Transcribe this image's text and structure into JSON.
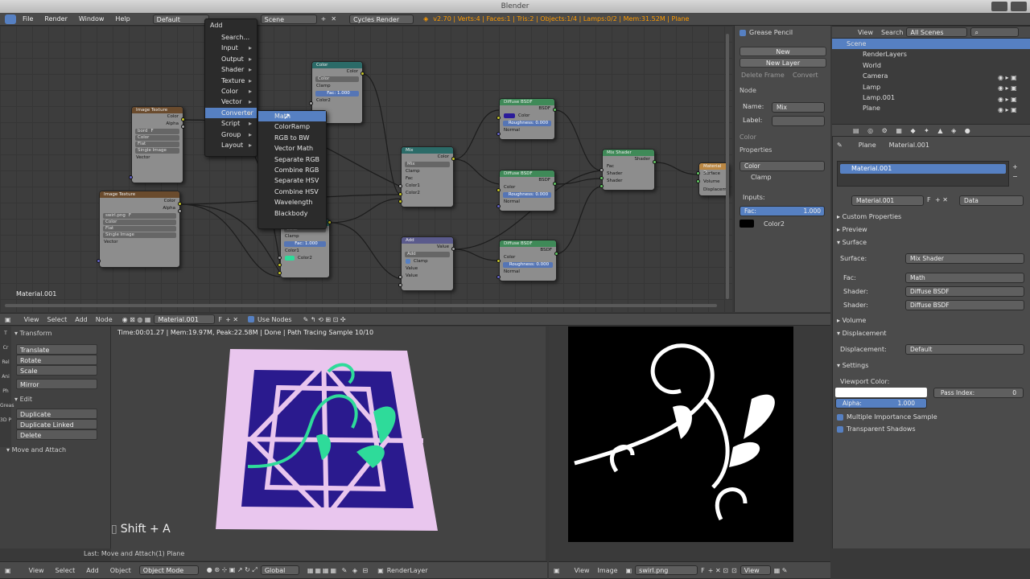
{
  "window": {
    "title": "Blender"
  },
  "topbar": {
    "menus": [
      "File",
      "Render",
      "Window",
      "Help"
    ],
    "screen": "Default",
    "scene": "Scene",
    "engine": "Cycles Render",
    "stats": "v2.70 | Verts:4 | Faces:1 | Tris:2 | Objects:1/4 | Lamps:0/2 | Mem:31.52M | Plane"
  },
  "add_menu": {
    "title": "Add",
    "items": [
      "Search...",
      "Input",
      "Output",
      "Shader",
      "Texture",
      "Color",
      "Vector",
      "Converter",
      "Script",
      "Group",
      "Layout"
    ]
  },
  "converter_menu": {
    "items": [
      "Math",
      "ColorRamp",
      "RGB to BW",
      "Vector Math",
      "Separate RGB",
      "Combine RGB",
      "Separate HSV",
      "Combine HSV",
      "Wavelength",
      "Blackbody"
    ]
  },
  "nodes": {
    "image1": {
      "title": "Image Texture",
      "out1": "Color",
      "out2": "Alpha",
      "img": "bord",
      "f": "F",
      "f1": "Color",
      "f2": "Flat",
      "f3": "Single Image",
      "in1": "Vector"
    },
    "image2": {
      "title": "Image Texture",
      "out1": "Color",
      "out2": "Alpha",
      "img": "swirl.png",
      "f": "F",
      "f1": "Color",
      "f2": "Flat",
      "f3": "Single Image",
      "in1": "Vector"
    },
    "color": {
      "title": "Color",
      "out1": "Color",
      "f1": "Color",
      "clamp": "Clamp",
      "fac": "Fac:",
      "facv": "1.000",
      "in": "Color2"
    },
    "mix_sm": {
      "f1": "Color",
      "clamp": "Clamp",
      "fac": "Fac:",
      "facv": "1.000",
      "in1": "Color1",
      "in2": "Color2"
    },
    "mix": {
      "title": "Mix",
      "out": "Color",
      "f": "Mix",
      "clamp": "Clamp",
      "fac": "Fac",
      "in1": "Color1",
      "in2": "Color2"
    },
    "add": {
      "title": "Add",
      "out": "Value",
      "f": "Add",
      "clamp": "Clamp",
      "in1": "Value",
      "in2": "Value"
    },
    "d1": {
      "title": "Diffuse BSDF",
      "out": "BSDF",
      "in1": "Color",
      "rough": "Roughness:",
      "roughv": "0.000",
      "in2": "Normal"
    },
    "d2": {
      "title": "Diffuse BSDF",
      "out": "BSDF",
      "in1": "Color",
      "rough": "Roughness:",
      "roughv": "0.000",
      "in2": "Normal"
    },
    "d3": {
      "title": "Diffuse BSDF",
      "out": "BSDF",
      "in1": "Color",
      "rough": "Roughness:",
      "roughv": "0.000",
      "in2": "Normal"
    },
    "mixsh": {
      "title": "Mix Shader",
      "out": "Shader",
      "in1": "Fac",
      "in2": "Shader",
      "in3": "Shader"
    },
    "out": {
      "title": "Material O...",
      "in1": "Surface",
      "in2": "Volume",
      "in3": "Displacement"
    }
  },
  "node_editor": {
    "material_label": "Material.001"
  },
  "node_header": {
    "items": [
      "View",
      "Select",
      "Add",
      "Node"
    ],
    "material": "Material.001",
    "f": "F",
    "use_nodes": "Use Nodes"
  },
  "npanel": {
    "grease": "Grease Pencil",
    "new": "New",
    "new_layer": "New Layer",
    "delete_frame": "Delete Frame",
    "convert": "Convert",
    "node": "Node",
    "name_label": "Name:",
    "name_val": "Mix",
    "label_label": "Label:",
    "color": "Color",
    "properties": "Properties",
    "color_field": "Color",
    "clamp": "Clamp",
    "inputs": "Inputs:",
    "fac": "Fac:",
    "facv": "1.000",
    "color2": "Color2"
  },
  "outliner": {
    "header": [
      "View",
      "Search"
    ],
    "scenes": "All Scenes",
    "rows": [
      "Scene",
      "RenderLayers",
      "World",
      "Camera",
      "Lamp",
      "Lamp.001",
      "Plane"
    ]
  },
  "props": {
    "crumbs": [
      "Plane",
      "Material.001"
    ],
    "slot": "Material.001",
    "mat": "Material.001",
    "f": "F",
    "data": "Data",
    "sections": {
      "custom": "Custom Properties",
      "preview": "Preview",
      "surface": "Surface",
      "volume": "Volume",
      "displacement": "Displacement",
      "settings": "Settings"
    },
    "surface_label": "Surface:",
    "surface_val": "Mix Shader",
    "fac_label": "Fac:",
    "fac_val": "Math",
    "shader1_label": "Shader:",
    "shader1_val": "Diffuse BSDF",
    "shader2_label": "Shader:",
    "shader2_val": "Diffuse BSDF",
    "disp_label": "Displacement:",
    "disp_val": "Default",
    "vp_color": "Viewport Color:",
    "pass": "Pass Index:",
    "pass_val": "0",
    "alpha": "Alpha:",
    "alpha_val": "1.000",
    "mis": "Multiple Importance Sample",
    "ts": "Transparent Shadows"
  },
  "tool": {
    "transform": "Transform",
    "translate": "Translate",
    "rotate": "Rotate",
    "scale": "Scale",
    "mirror": "Mirror",
    "edit": "Edit",
    "duplicate": "Duplicate",
    "dup_linked": "Duplicate Linked",
    "delete": "Delete",
    "move_attach": "Move and Attach",
    "tabs": [
      "T",
      "Cr",
      "Rel",
      "Ani",
      "Ph",
      "Greas",
      "3D P"
    ]
  },
  "viewport": {
    "status": "Time:00:01.27 | Mem:19.97M, Peak:22.58M | Done | Path Tracing Sample 10/10",
    "shortcut": "Shift + A",
    "last": "Last: Move and Attach(1) Plane"
  },
  "bottom": {
    "items": [
      "View",
      "Select",
      "Add",
      "Object"
    ],
    "mode": "Object Mode",
    "global": "Global",
    "renderlayer": "RenderLayer",
    "img_items": [
      "View",
      "Image"
    ],
    "img": "swirl.png",
    "f": "F",
    "view": "View"
  }
}
